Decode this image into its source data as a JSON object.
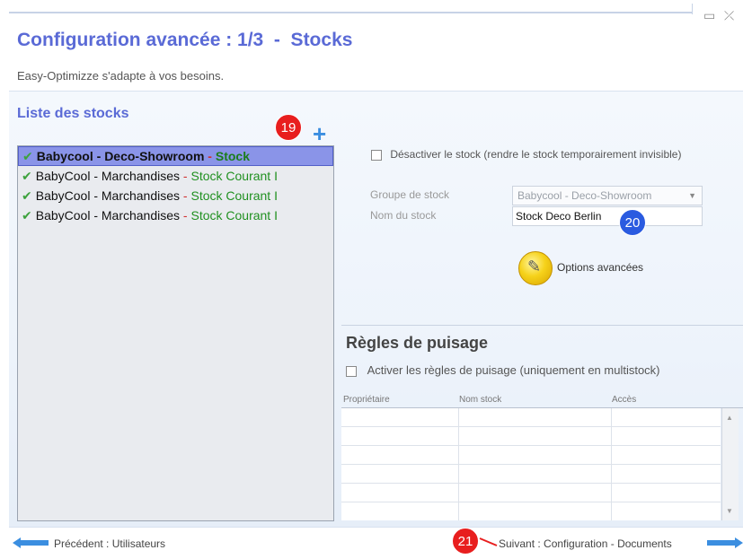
{
  "window": {
    "title": "Configuration avancée : 1/3  -  Stocks",
    "subtitle": "Easy-Optimizze s'adapte à vos besoins.",
    "minimize_glyph": "▭",
    "close_glyph": "⤫"
  },
  "stock_list": {
    "heading": "Liste des stocks",
    "add_glyph": "+",
    "items": [
      {
        "name": "Babycool - Deco-Showroom",
        "sep": " - ",
        "type": "Stock",
        "selected": true
      },
      {
        "name": "BabyCool - Marchandises",
        "sep": " - ",
        "type": "Stock Courant I",
        "selected": false
      },
      {
        "name": "BabyCool - Marchandises",
        "sep": " - ",
        "type": "Stock Courant I",
        "selected": false
      },
      {
        "name": "BabyCool - Marchandises",
        "sep": " - ",
        "type": "Stock Courant I",
        "selected": false
      }
    ]
  },
  "details": {
    "deactivate_label": "Désactiver le stock (rendre le stock temporairement invisible)",
    "group_label": "Groupe de stock",
    "group_value": "Babycool - Deco-Showroom",
    "name_label": "Nom du stock",
    "name_value": "Stock Deco Berlin",
    "advanced_options": "Options avancées"
  },
  "rules": {
    "heading": "Règles de puisage",
    "activate_label": "Activer les règles de puisage (uniquement en multistock)",
    "columns": [
      "Propriétaire",
      "Nom stock",
      "Accès"
    ],
    "scroll_up": "▲",
    "scroll_down": "▼"
  },
  "nav": {
    "prev": "Précédent : Utilisateurs",
    "next": "Suivant : Configuration - Documents"
  },
  "annotations": {
    "badge1": "19",
    "badge2": "20",
    "badge3": "21"
  },
  "colors": {
    "title": "#5a6ad6",
    "selection": "#8a94e8",
    "check": "#3da23d",
    "stock_type": "#209020",
    "badge_red": "#e81e1e",
    "badge_blue": "#2a5be0",
    "nav_arrow": "#3b8ee0"
  }
}
